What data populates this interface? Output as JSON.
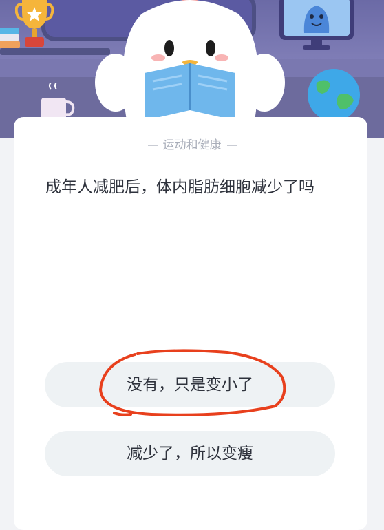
{
  "question": {
    "category": "运动和健康",
    "text": "成年人减肥后，体内脂肪细胞减少了吗"
  },
  "options": [
    {
      "label": "没有，只是变小了",
      "circled": true
    },
    {
      "label": "减少了，所以变瘦",
      "circled": false
    }
  ],
  "colors": {
    "banner": "#7a78b0",
    "card": "#ffffff",
    "option_bg": "#eef2f4",
    "annotation": "#e8401d"
  }
}
